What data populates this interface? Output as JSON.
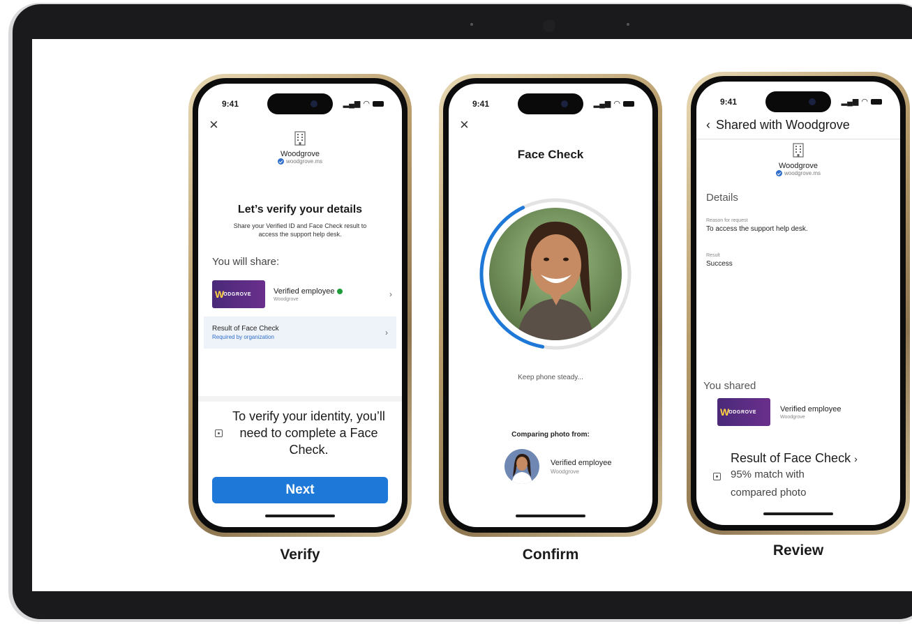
{
  "phones": {
    "verify": {
      "label": "Verify",
      "status_time": "9:41",
      "org_name": "Woodgrove",
      "org_domain": "woodgrove.ms",
      "title": "Let’s verify your details",
      "subtitle": "Share your Verified ID and Face Check result to access the support help desk.",
      "share_heading": "You will share:",
      "credential": {
        "logo_text": "ODGROVE",
        "name": "Verified employee",
        "org": "Woodgrove"
      },
      "face_check": {
        "title": "Result of Face Check",
        "required": "Required by organization"
      },
      "info": "To verify your identity, you’ll need to complete a Face Check.",
      "next_label": "Next"
    },
    "confirm": {
      "label": "Confirm",
      "status_time": "9:41",
      "title": "Face Check",
      "progress": 0.4,
      "steady_text": "Keep phone steady...",
      "compare_heading": "Comparing photo from:",
      "ref_name": "Verified employee",
      "ref_org": "Woodgrove"
    },
    "review": {
      "label": "Review",
      "status_time": "9:41",
      "header": "Shared with Woodgrove",
      "org_name": "Woodgrove",
      "org_domain": "woodgrove.ms",
      "details_heading": "Details",
      "reason_label": "Reason for request",
      "reason_value": "To access the support help desk.",
      "result_label": "Result",
      "result_value": "Success",
      "shared_heading": "You shared",
      "credential": {
        "logo_text": "ODGROVE",
        "name": "Verified employee",
        "org": "Woodgrove"
      },
      "face_title": "Result of Face Check",
      "face_sub_1": "95% match with",
      "face_sub_2": "compared photo"
    }
  },
  "colors": {
    "accent": "#1e78d8",
    "badge": "#2f6ecb",
    "check_green": "#1f9d3a",
    "card_purple": "#4a2a79"
  }
}
